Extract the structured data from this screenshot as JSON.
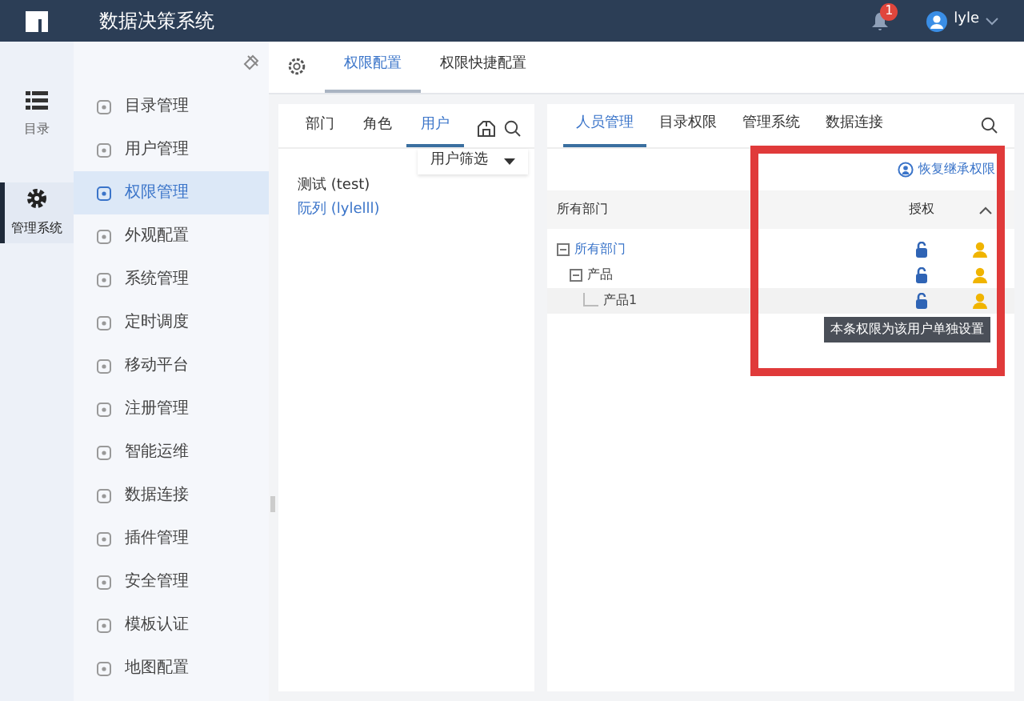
{
  "header": {
    "title": "数据决策系统",
    "notification_count": "1",
    "user": "lyle"
  },
  "rail": [
    {
      "label": "目录",
      "kind": "list",
      "selected": false
    },
    {
      "label": "管理系统",
      "kind": "gear",
      "selected": true
    }
  ],
  "menu": [
    {
      "label": "目录管理",
      "selected": false
    },
    {
      "label": "用户管理",
      "selected": false
    },
    {
      "label": "权限管理",
      "selected": true
    },
    {
      "label": "外观配置",
      "selected": false
    },
    {
      "label": "系统管理",
      "selected": false
    },
    {
      "label": "定时调度",
      "selected": false
    },
    {
      "label": "移动平台",
      "selected": false
    },
    {
      "label": "注册管理",
      "selected": false
    },
    {
      "label": "智能运维",
      "selected": false
    },
    {
      "label": "数据连接",
      "selected": false
    },
    {
      "label": "插件管理",
      "selected": false
    },
    {
      "label": "安全管理",
      "selected": false
    },
    {
      "label": "模板认证",
      "selected": false
    },
    {
      "label": "地图配置",
      "selected": false
    }
  ],
  "top_tabs": [
    {
      "label": "权限配置",
      "selected": true
    },
    {
      "label": "权限快捷配置",
      "selected": false
    }
  ],
  "left_panel": {
    "tabs": [
      {
        "label": "部门",
        "selected": false
      },
      {
        "label": "角色",
        "selected": false
      },
      {
        "label": "用户",
        "selected": true
      }
    ],
    "filter": "用户筛选",
    "users": [
      {
        "label": "测试 (test)",
        "selected": false
      },
      {
        "label": "阮列 (lylelll)",
        "selected": true
      }
    ]
  },
  "right_panel": {
    "tabs": [
      {
        "label": "人员管理",
        "selected": true
      },
      {
        "label": "目录权限",
        "selected": false
      },
      {
        "label": "管理系统",
        "selected": false
      },
      {
        "label": "数据连接",
        "selected": false
      }
    ],
    "restore_link": "恢复继承权限",
    "columns": [
      "所有部门",
      "授权"
    ],
    "tree": [
      {
        "label": "所有部门",
        "expanded": true,
        "selected": false,
        "children": [
          {
            "label": "产品",
            "expanded": true,
            "selected": false,
            "children": [
              {
                "label": "产品1",
                "selected": true
              }
            ]
          }
        ]
      }
    ],
    "tooltip": "本条权限为该用户单独设置"
  }
}
